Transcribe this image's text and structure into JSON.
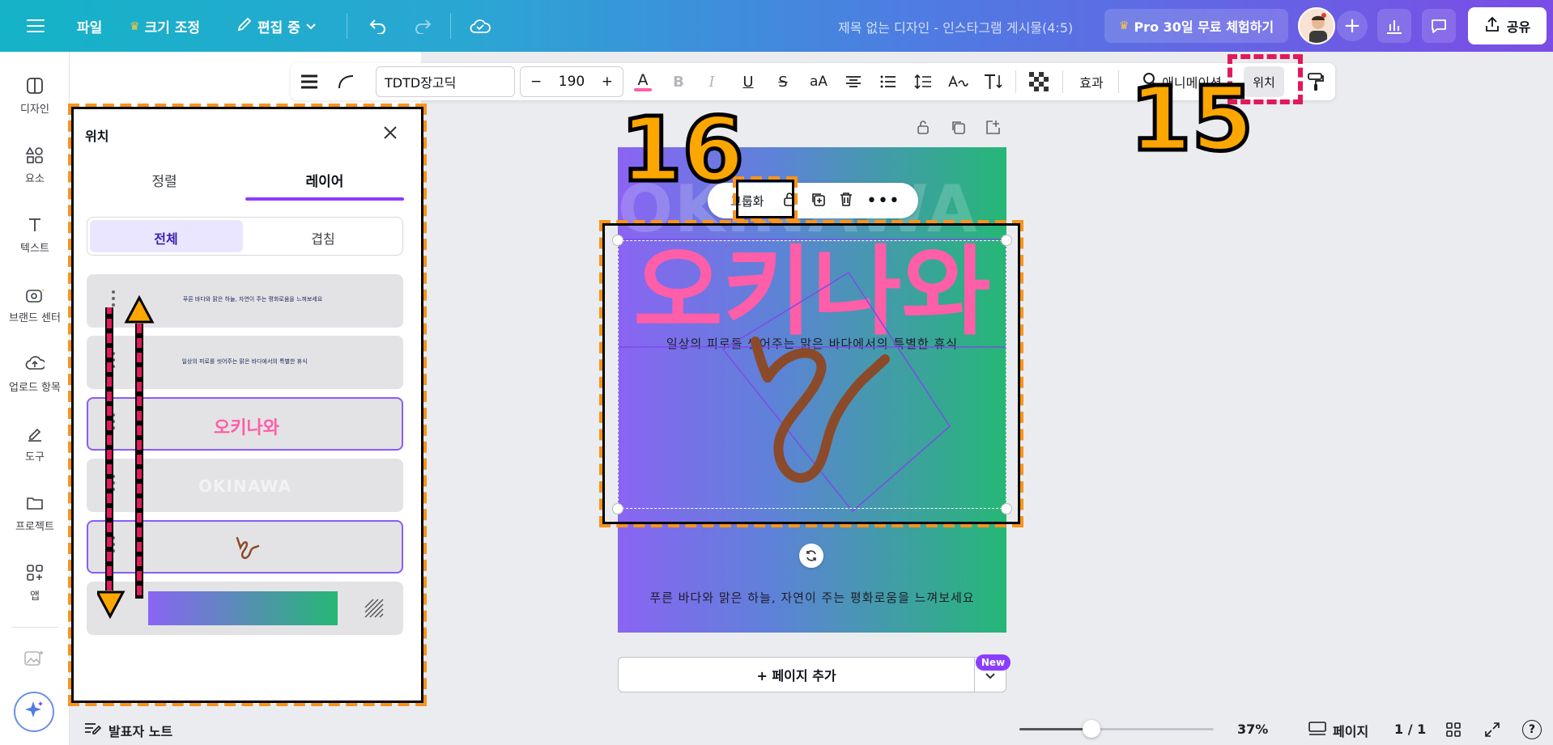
{
  "topbar": {
    "file": "파일",
    "resize": "크기 조정",
    "editing": "편집 중",
    "doc_title": "제목 없는 디자인 - 인스타그램 게시물(4:5)",
    "pro_trial": "Pro 30일 무료 체험하기",
    "share": "공유"
  },
  "rail": {
    "items": [
      {
        "label": "디자인",
        "icon": "design-icon"
      },
      {
        "label": "요소",
        "icon": "elements-icon"
      },
      {
        "label": "텍스트",
        "icon": "text-icon"
      },
      {
        "label": "브랜드 센터",
        "icon": "brand-icon"
      },
      {
        "label": "업로드 항목",
        "icon": "upload-icon"
      },
      {
        "label": "도구",
        "icon": "tools-icon"
      },
      {
        "label": "프로젝트",
        "icon": "folder-icon"
      },
      {
        "label": "앱",
        "icon": "apps-icon"
      }
    ]
  },
  "panel": {
    "title": "위치",
    "tabs": [
      "정렬",
      "레이어"
    ],
    "active_tab": "레이어",
    "segments": [
      "전체",
      "겹침"
    ],
    "layers": [
      {
        "label": "푸른 바다와 맑은 하늘, 자연이 주는 평화로움을 느껴보세요",
        "type": "text-small"
      },
      {
        "label": "일상의 피로를 씻어주는 맑은 바다에서의 특별한 휴식",
        "type": "text-small"
      },
      {
        "label": "오키나와",
        "type": "text-pink",
        "selected": true
      },
      {
        "label": "OKINAWA",
        "type": "text-faint"
      },
      {
        "label": "",
        "type": "scribble",
        "selected": true
      },
      {
        "label": "",
        "type": "background"
      }
    ]
  },
  "toolbar": {
    "font": "TDTD장고딕",
    "size": "190",
    "minus": "−",
    "plus": "+",
    "effects": "효과",
    "animate": "애니메이션",
    "position": "위치"
  },
  "canvas": {
    "bg_word": "OKINAWA",
    "title": "오키나와",
    "subtitle": "일상의 피로를 씻어주는 맑은 바다에서의 특별한 휴식",
    "footer": "푸른 바다와 맑은 하늘, 자연이 주는 평화로움을 느껴보세요",
    "group": "그룹화",
    "add_page": "+ 페이지 추가",
    "new_badge": "New"
  },
  "bottom": {
    "notes": "발표자 노트",
    "zoom": "37%",
    "zoom_fraction": 0.37,
    "pages_label": "페이지",
    "page_count": "1 / 1"
  },
  "annotations": {
    "step_15": "15",
    "step_16": "16"
  },
  "colors": {
    "accent": "#8b3dff",
    "annotation_orange": "#f7941d",
    "annotation_red": "#e0195a",
    "title_pink": "#ff5ea8"
  }
}
